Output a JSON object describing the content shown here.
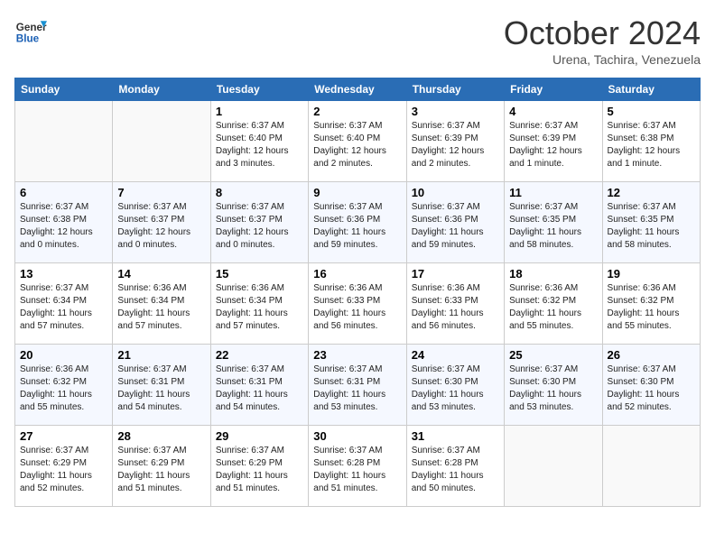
{
  "header": {
    "logo_line1": "General",
    "logo_line2": "Blue",
    "month": "October 2024",
    "location": "Urena, Tachira, Venezuela"
  },
  "days_of_week": [
    "Sunday",
    "Monday",
    "Tuesday",
    "Wednesday",
    "Thursday",
    "Friday",
    "Saturday"
  ],
  "weeks": [
    [
      {
        "day": "",
        "sunrise": "",
        "sunset": "",
        "daylight": ""
      },
      {
        "day": "",
        "sunrise": "",
        "sunset": "",
        "daylight": ""
      },
      {
        "day": "1",
        "sunrise": "Sunrise: 6:37 AM",
        "sunset": "Sunset: 6:40 PM",
        "daylight": "Daylight: 12 hours and 3 minutes."
      },
      {
        "day": "2",
        "sunrise": "Sunrise: 6:37 AM",
        "sunset": "Sunset: 6:40 PM",
        "daylight": "Daylight: 12 hours and 2 minutes."
      },
      {
        "day": "3",
        "sunrise": "Sunrise: 6:37 AM",
        "sunset": "Sunset: 6:39 PM",
        "daylight": "Daylight: 12 hours and 2 minutes."
      },
      {
        "day": "4",
        "sunrise": "Sunrise: 6:37 AM",
        "sunset": "Sunset: 6:39 PM",
        "daylight": "Daylight: 12 hours and 1 minute."
      },
      {
        "day": "5",
        "sunrise": "Sunrise: 6:37 AM",
        "sunset": "Sunset: 6:38 PM",
        "daylight": "Daylight: 12 hours and 1 minute."
      }
    ],
    [
      {
        "day": "6",
        "sunrise": "Sunrise: 6:37 AM",
        "sunset": "Sunset: 6:38 PM",
        "daylight": "Daylight: 12 hours and 0 minutes."
      },
      {
        "day": "7",
        "sunrise": "Sunrise: 6:37 AM",
        "sunset": "Sunset: 6:37 PM",
        "daylight": "Daylight: 12 hours and 0 minutes."
      },
      {
        "day": "8",
        "sunrise": "Sunrise: 6:37 AM",
        "sunset": "Sunset: 6:37 PM",
        "daylight": "Daylight: 12 hours and 0 minutes."
      },
      {
        "day": "9",
        "sunrise": "Sunrise: 6:37 AM",
        "sunset": "Sunset: 6:36 PM",
        "daylight": "Daylight: 11 hours and 59 minutes."
      },
      {
        "day": "10",
        "sunrise": "Sunrise: 6:37 AM",
        "sunset": "Sunset: 6:36 PM",
        "daylight": "Daylight: 11 hours and 59 minutes."
      },
      {
        "day": "11",
        "sunrise": "Sunrise: 6:37 AM",
        "sunset": "Sunset: 6:35 PM",
        "daylight": "Daylight: 11 hours and 58 minutes."
      },
      {
        "day": "12",
        "sunrise": "Sunrise: 6:37 AM",
        "sunset": "Sunset: 6:35 PM",
        "daylight": "Daylight: 11 hours and 58 minutes."
      }
    ],
    [
      {
        "day": "13",
        "sunrise": "Sunrise: 6:37 AM",
        "sunset": "Sunset: 6:34 PM",
        "daylight": "Daylight: 11 hours and 57 minutes."
      },
      {
        "day": "14",
        "sunrise": "Sunrise: 6:36 AM",
        "sunset": "Sunset: 6:34 PM",
        "daylight": "Daylight: 11 hours and 57 minutes."
      },
      {
        "day": "15",
        "sunrise": "Sunrise: 6:36 AM",
        "sunset": "Sunset: 6:34 PM",
        "daylight": "Daylight: 11 hours and 57 minutes."
      },
      {
        "day": "16",
        "sunrise": "Sunrise: 6:36 AM",
        "sunset": "Sunset: 6:33 PM",
        "daylight": "Daylight: 11 hours and 56 minutes."
      },
      {
        "day": "17",
        "sunrise": "Sunrise: 6:36 AM",
        "sunset": "Sunset: 6:33 PM",
        "daylight": "Daylight: 11 hours and 56 minutes."
      },
      {
        "day": "18",
        "sunrise": "Sunrise: 6:36 AM",
        "sunset": "Sunset: 6:32 PM",
        "daylight": "Daylight: 11 hours and 55 minutes."
      },
      {
        "day": "19",
        "sunrise": "Sunrise: 6:36 AM",
        "sunset": "Sunset: 6:32 PM",
        "daylight": "Daylight: 11 hours and 55 minutes."
      }
    ],
    [
      {
        "day": "20",
        "sunrise": "Sunrise: 6:36 AM",
        "sunset": "Sunset: 6:32 PM",
        "daylight": "Daylight: 11 hours and 55 minutes."
      },
      {
        "day": "21",
        "sunrise": "Sunrise: 6:37 AM",
        "sunset": "Sunset: 6:31 PM",
        "daylight": "Daylight: 11 hours and 54 minutes."
      },
      {
        "day": "22",
        "sunrise": "Sunrise: 6:37 AM",
        "sunset": "Sunset: 6:31 PM",
        "daylight": "Daylight: 11 hours and 54 minutes."
      },
      {
        "day": "23",
        "sunrise": "Sunrise: 6:37 AM",
        "sunset": "Sunset: 6:31 PM",
        "daylight": "Daylight: 11 hours and 53 minutes."
      },
      {
        "day": "24",
        "sunrise": "Sunrise: 6:37 AM",
        "sunset": "Sunset: 6:30 PM",
        "daylight": "Daylight: 11 hours and 53 minutes."
      },
      {
        "day": "25",
        "sunrise": "Sunrise: 6:37 AM",
        "sunset": "Sunset: 6:30 PM",
        "daylight": "Daylight: 11 hours and 53 minutes."
      },
      {
        "day": "26",
        "sunrise": "Sunrise: 6:37 AM",
        "sunset": "Sunset: 6:30 PM",
        "daylight": "Daylight: 11 hours and 52 minutes."
      }
    ],
    [
      {
        "day": "27",
        "sunrise": "Sunrise: 6:37 AM",
        "sunset": "Sunset: 6:29 PM",
        "daylight": "Daylight: 11 hours and 52 minutes."
      },
      {
        "day": "28",
        "sunrise": "Sunrise: 6:37 AM",
        "sunset": "Sunset: 6:29 PM",
        "daylight": "Daylight: 11 hours and 51 minutes."
      },
      {
        "day": "29",
        "sunrise": "Sunrise: 6:37 AM",
        "sunset": "Sunset: 6:29 PM",
        "daylight": "Daylight: 11 hours and 51 minutes."
      },
      {
        "day": "30",
        "sunrise": "Sunrise: 6:37 AM",
        "sunset": "Sunset: 6:28 PM",
        "daylight": "Daylight: 11 hours and 51 minutes."
      },
      {
        "day": "31",
        "sunrise": "Sunrise: 6:37 AM",
        "sunset": "Sunset: 6:28 PM",
        "daylight": "Daylight: 11 hours and 50 minutes."
      },
      {
        "day": "",
        "sunrise": "",
        "sunset": "",
        "daylight": ""
      },
      {
        "day": "",
        "sunrise": "",
        "sunset": "",
        "daylight": ""
      }
    ]
  ]
}
